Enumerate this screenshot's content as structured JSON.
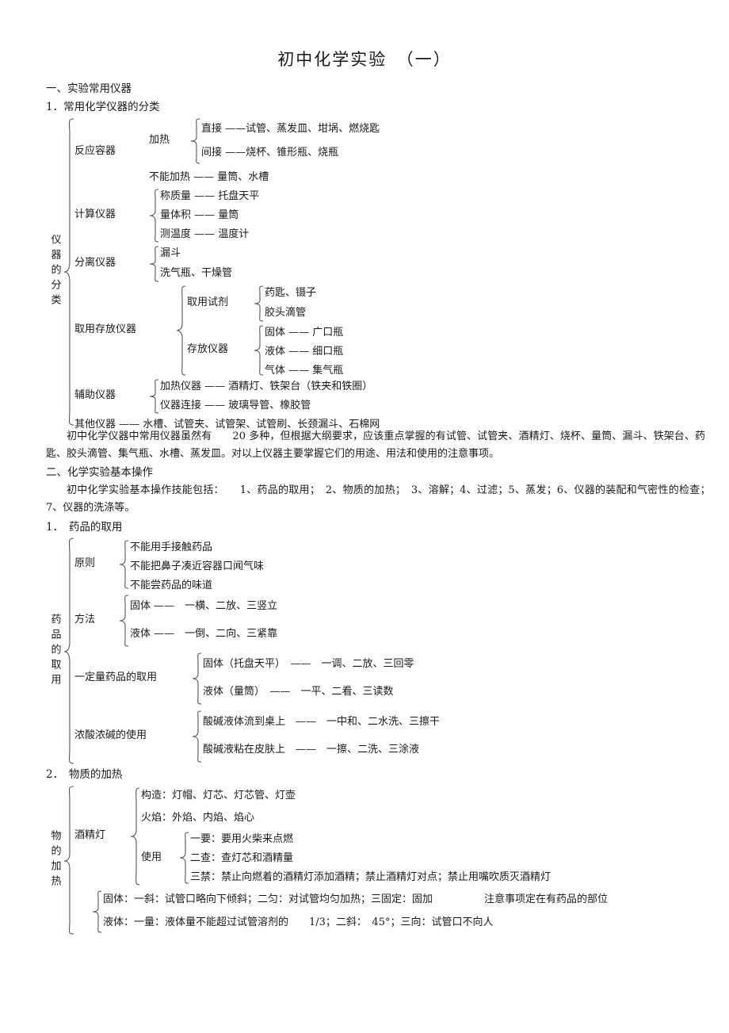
{
  "document": {
    "title": "初中化学实验　（一）",
    "sections": [
      {
        "id": "sec1",
        "heading": "一、实验常用仪器"
      },
      {
        "id": "sub1",
        "heading": "1．常用化学仪器的分类"
      },
      {
        "id": "sec2",
        "heading": "二、化学实验基本操作"
      },
      {
        "id": "sub2",
        "heading": "1．　药品的取用"
      },
      {
        "id": "sub3",
        "heading": "2．　物质的加热"
      }
    ],
    "paragraphs": {
      "p1": "初中化学仪器中常用仪器虽然有　　20 多种，但根据大纲要求，应该重点掌握的有试管、试管夹、酒精灯、烧杯、量筒、漏斗、铁架台、药匙、胶头滴管、集气瓶、水槽、蒸发皿。对以上仪器主要掌握它们的用途、用法和使用的注意事项。",
      "p2": "初中化学实验基本操作技能包括：　　1、药品的取用；　2、物质的加热；　3、溶解；4、过滤；5、蒸发；6、仪器的装配和气密性的检查；　7、仪器的洗涤等。"
    }
  },
  "diagram1": {
    "root_label": "仪器的分类",
    "branches": [
      {
        "label": "反应容器",
        "subgroups": [
          {
            "label": "加热",
            "leaves": [
              "直接 ——试管、蒸发皿、坩埚、燃烧匙",
              "间接 ——烧杯、锥形瓶、烧瓶"
            ]
          }
        ],
        "plain_leaves": [
          "不能加热 —— 量筒、水槽"
        ]
      },
      {
        "label": "计算仪器",
        "leaves": [
          "称质量 —— 托盘天平",
          "量体积 —— 量筒",
          "测温度 —— 温度计"
        ]
      },
      {
        "label": "分离仪器",
        "leaves": [
          "漏斗",
          "洗气瓶、干燥管"
        ]
      },
      {
        "label": "取用存放仪器",
        "subgroups": [
          {
            "label": "取用试剂",
            "leaves": [
              "药匙、镊子",
              "胶头滴管"
            ]
          },
          {
            "label": "存放仪器",
            "leaves": [
              "固体 —— 广口瓶",
              "液体 —— 细口瓶",
              "气体 —— 集气瓶"
            ]
          }
        ]
      },
      {
        "label": "辅助仪器",
        "leaves": [
          "加热仪器 —— 酒精灯、铁架台（铁夹和铁圈）",
          "仪器连接 —— 玻璃导管、橡胶管"
        ]
      },
      {
        "label": "其他仪器 —— 水槽、试管夹、试管架、试管刷、长颈漏斗、石棉网",
        "standalone": true
      }
    ]
  },
  "diagram2": {
    "root_label": "药品的取用",
    "branches": [
      {
        "label": "原则",
        "leaves": [
          "不能用手接触药品",
          "不能把鼻子凑近容器口闻气味",
          "不能尝药品的味道"
        ]
      },
      {
        "label": "方法",
        "leaves": [
          "固体 ——　一横、二放、三竖立",
          "液体 ——　一倒、二向、三紧靠"
        ]
      },
      {
        "label": "一定量药品的取用",
        "leaves": [
          "固体（托盘天平）　——　一调、二放、三回零",
          "液体（量筒）　——　一平、二看、三读数"
        ]
      },
      {
        "label": "浓酸浓碱的使用",
        "leaves": [
          "酸碱液体流到桌上　——　一中和、二水洗、三擦干",
          "酸碱液粘在皮肤上　——　一擦、二洗、三涂液"
        ]
      }
    ]
  },
  "diagram3": {
    "root_label": "物的加热",
    "branches": [
      {
        "label": "酒精灯",
        "leaves": [
          "构造：灯帽、灯芯、灯芯管、灯壶",
          "火焰：外焰、内焰、焰心"
        ],
        "subgroups": [
          {
            "label": "使用",
            "leaves": [
              "一要：要用火柴来点燃",
              "二查：查灯芯和酒精量",
              "三禁：禁止向燃着的酒精灯添加酒精；禁止酒精灯对点；禁止用嘴吹质灭酒精灯"
            ]
          }
        ]
      },
      {
        "label": "",
        "leaves": [
          "固体：一斜：试管口略向下倾斜；二匀：对试管均匀加热；三固定：固加　　　　　注意事项定在有药品的部位",
          "液体：一量：液体量不能超过试管溶剂的　　1/3；二斜：　45°；三向：试管口不向人"
        ]
      }
    ]
  },
  "colors": {
    "text": "#1a1a1a",
    "brace": "#555555",
    "background": "#ffffff"
  }
}
